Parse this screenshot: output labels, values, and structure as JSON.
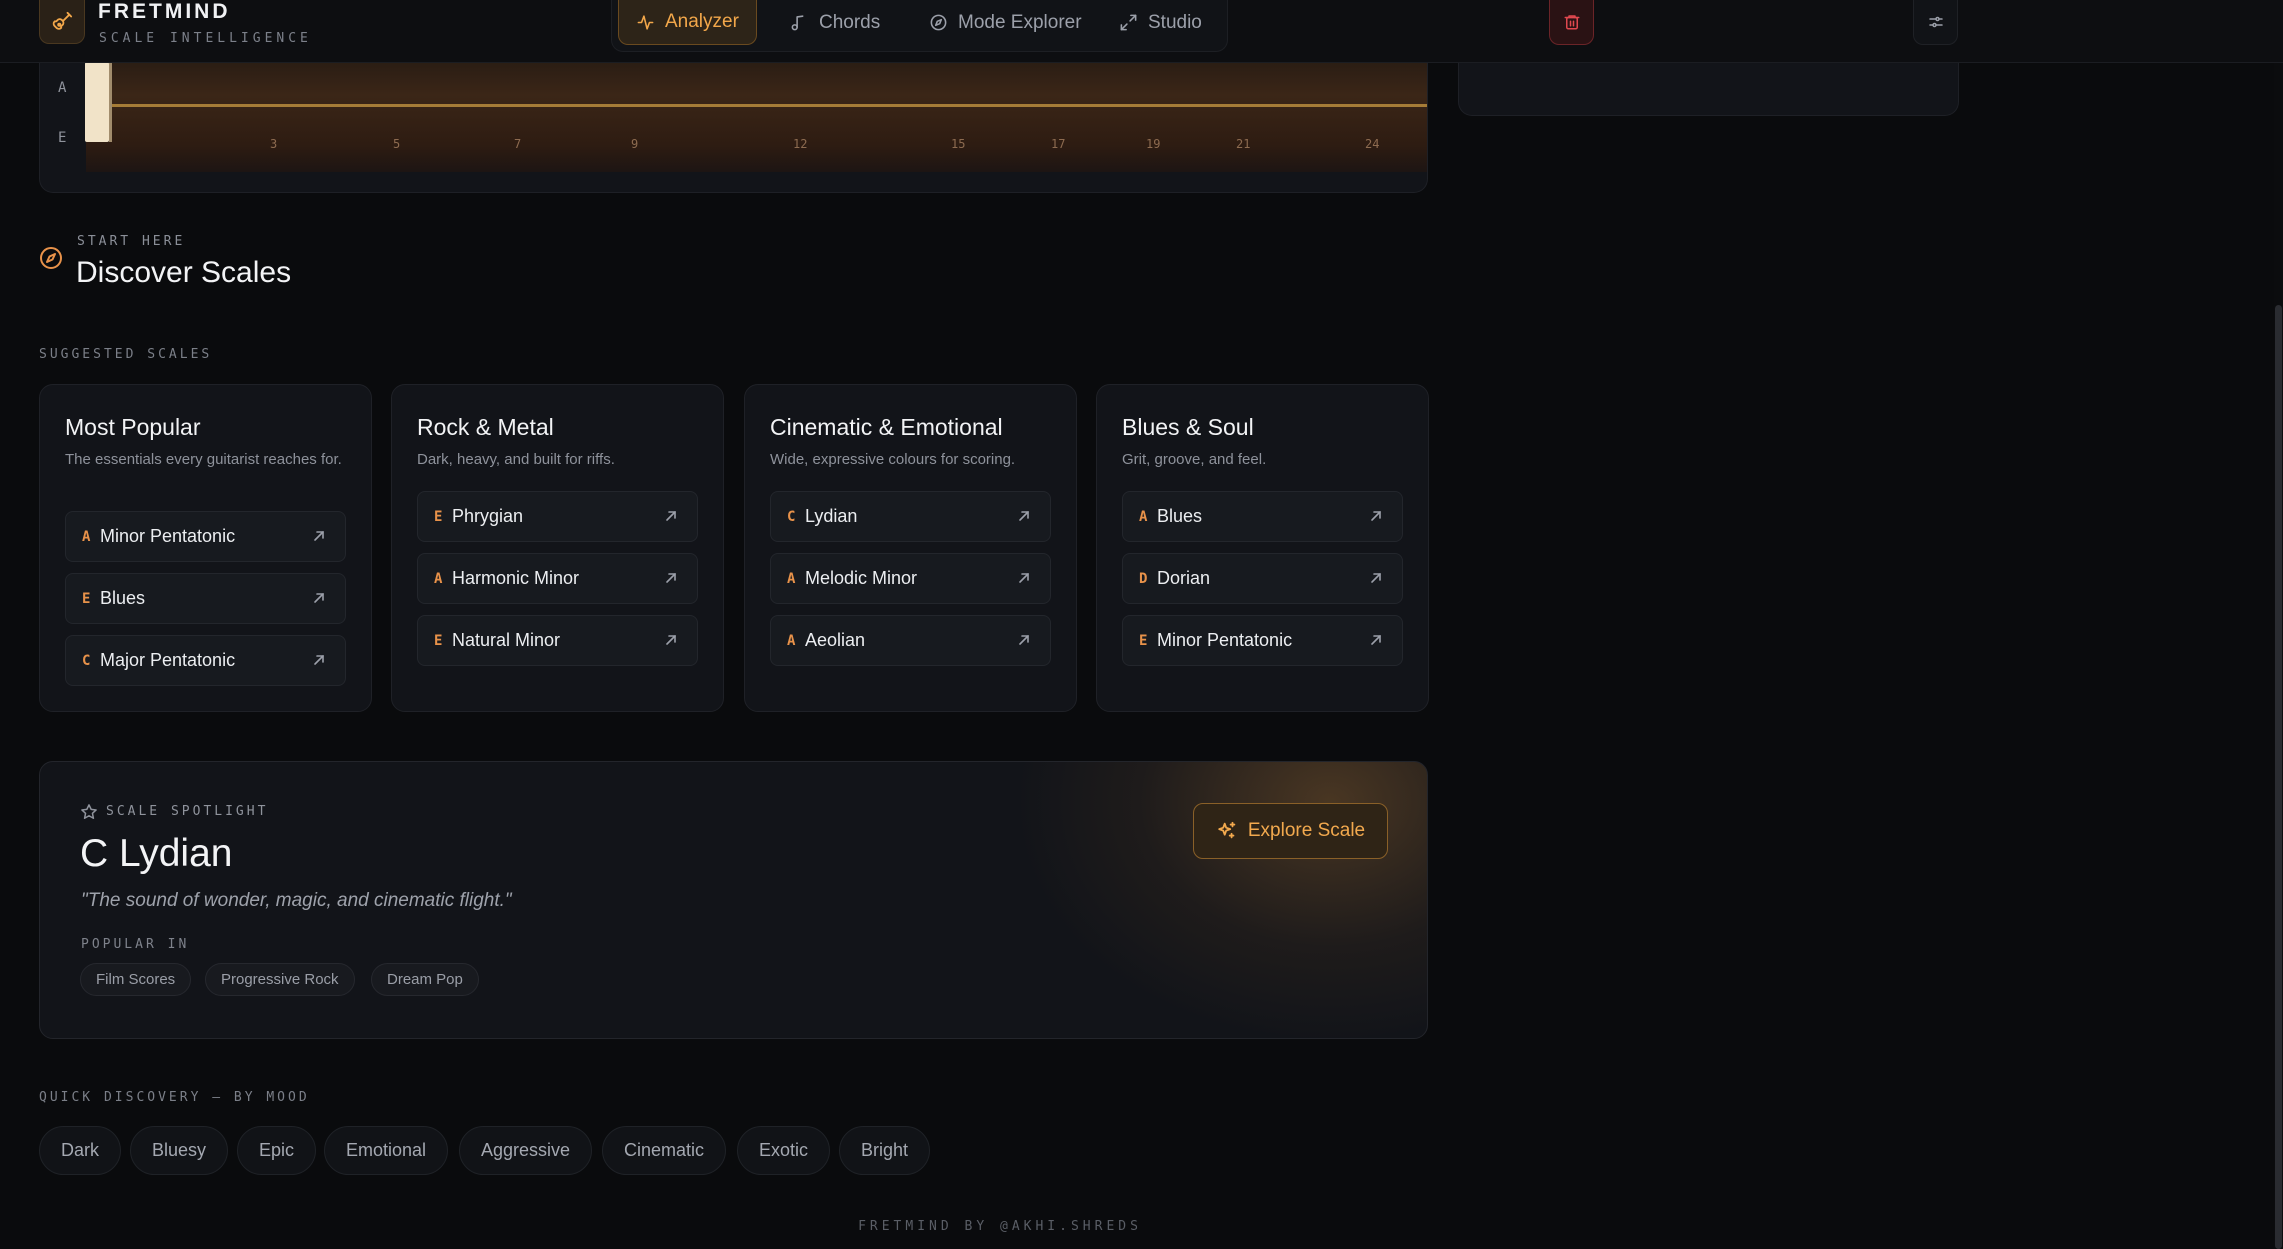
{
  "header": {
    "brand_name": "FRETMIND",
    "brand_sub": "SCALE INTELLIGENCE",
    "nav": [
      {
        "label": "Analyzer",
        "icon": "pulse-icon",
        "active": true
      },
      {
        "label": "Chords",
        "icon": "music-note-icon",
        "active": false
      },
      {
        "label": "Mode Explorer",
        "icon": "compass-icon",
        "active": false
      },
      {
        "label": "Studio",
        "icon": "expand-icon",
        "active": false
      }
    ]
  },
  "fretboard": {
    "strings": [
      "A",
      "E"
    ],
    "fret_numbers": [
      "3",
      "5",
      "7",
      "9",
      "12",
      "15",
      "17",
      "19",
      "21",
      "24"
    ]
  },
  "discover": {
    "eyebrow": "START HERE",
    "title": "Discover Scales",
    "suggested_label": "SUGGESTED SCALES",
    "groups": [
      {
        "title": "Most Popular",
        "desc": "The essentials every guitarist reaches for.",
        "items": [
          {
            "root": "A",
            "name": "Minor Pentatonic"
          },
          {
            "root": "E",
            "name": "Blues"
          },
          {
            "root": "C",
            "name": "Major Pentatonic"
          }
        ]
      },
      {
        "title": "Rock & Metal",
        "desc": "Dark, heavy, and built for riffs.",
        "items": [
          {
            "root": "E",
            "name": "Phrygian"
          },
          {
            "root": "A",
            "name": "Harmonic Minor"
          },
          {
            "root": "E",
            "name": "Natural Minor"
          }
        ]
      },
      {
        "title": "Cinematic & Emotional",
        "desc": "Wide, expressive colours for scoring.",
        "items": [
          {
            "root": "C",
            "name": "Lydian"
          },
          {
            "root": "A",
            "name": "Melodic Minor"
          },
          {
            "root": "A",
            "name": "Aeolian"
          }
        ]
      },
      {
        "title": "Blues & Soul",
        "desc": "Grit, groove, and feel.",
        "items": [
          {
            "root": "A",
            "name": "Blues"
          },
          {
            "root": "D",
            "name": "Dorian"
          },
          {
            "root": "E",
            "name": "Minor Pentatonic"
          }
        ]
      }
    ]
  },
  "spotlight": {
    "eyebrow": "SCALE SPOTLIGHT",
    "title": "C Lydian",
    "quote": "\"The sound of wonder, magic, and cinematic flight.\"",
    "popular_label": "POPULAR IN",
    "tags": [
      "Film Scores",
      "Progressive Rock",
      "Dream Pop"
    ],
    "button_label": "Explore Scale"
  },
  "moods": {
    "label": "QUICK DISCOVERY — BY MOOD",
    "chips": [
      "Dark",
      "Bluesy",
      "Epic",
      "Emotional",
      "Aggressive",
      "Cinematic",
      "Exotic",
      "Bright"
    ]
  },
  "footer": "FRETMIND BY @AKHI.SHREDS",
  "colors": {
    "accent": "#f2a74a",
    "root_note": "#e8924a",
    "danger": "#e0484f",
    "background": "#0a0b0d",
    "card": "#121419"
  }
}
